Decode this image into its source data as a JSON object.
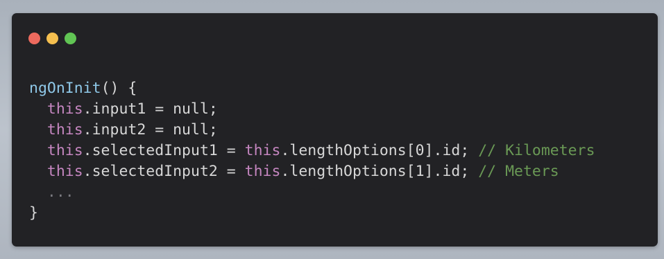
{
  "window": {
    "traffic_lights": [
      {
        "name": "close",
        "color": "#ed6a5e"
      },
      {
        "name": "minimize",
        "color": "#f5bf4f"
      },
      {
        "name": "zoom",
        "color": "#61c554"
      }
    ],
    "background_color": "#222225"
  },
  "code": {
    "lines": [
      {
        "tokens": [
          {
            "type": "fn",
            "text": "ngOnInit"
          },
          {
            "type": "punc",
            "text": "() {"
          }
        ]
      },
      {
        "tokens": [
          {
            "type": "punc",
            "text": "  "
          },
          {
            "type": "kw",
            "text": "this"
          },
          {
            "type": "punc",
            "text": ".input1 = null;"
          }
        ]
      },
      {
        "tokens": [
          {
            "type": "punc",
            "text": "  "
          },
          {
            "type": "kw",
            "text": "this"
          },
          {
            "type": "punc",
            "text": ".input2 = null;"
          }
        ]
      },
      {
        "tokens": [
          {
            "type": "punc",
            "text": "  "
          },
          {
            "type": "kw",
            "text": "this"
          },
          {
            "type": "punc",
            "text": ".selectedInput1 = "
          },
          {
            "type": "kw",
            "text": "this"
          },
          {
            "type": "punc",
            "text": ".lengthOptions[0].id; "
          },
          {
            "type": "cm",
            "text": "// Kilometers"
          }
        ]
      },
      {
        "tokens": [
          {
            "type": "punc",
            "text": "  "
          },
          {
            "type": "kw",
            "text": "this"
          },
          {
            "type": "punc",
            "text": ".selectedInput2 = "
          },
          {
            "type": "kw",
            "text": "this"
          },
          {
            "type": "punc",
            "text": ".lengthOptions[1].id; "
          },
          {
            "type": "cm",
            "text": "// Meters"
          }
        ]
      },
      {
        "tokens": [
          {
            "type": "punc",
            "text": "  "
          },
          {
            "type": "muted",
            "text": "..."
          }
        ]
      },
      {
        "tokens": [
          {
            "type": "punc",
            "text": "}"
          }
        ]
      }
    ]
  }
}
